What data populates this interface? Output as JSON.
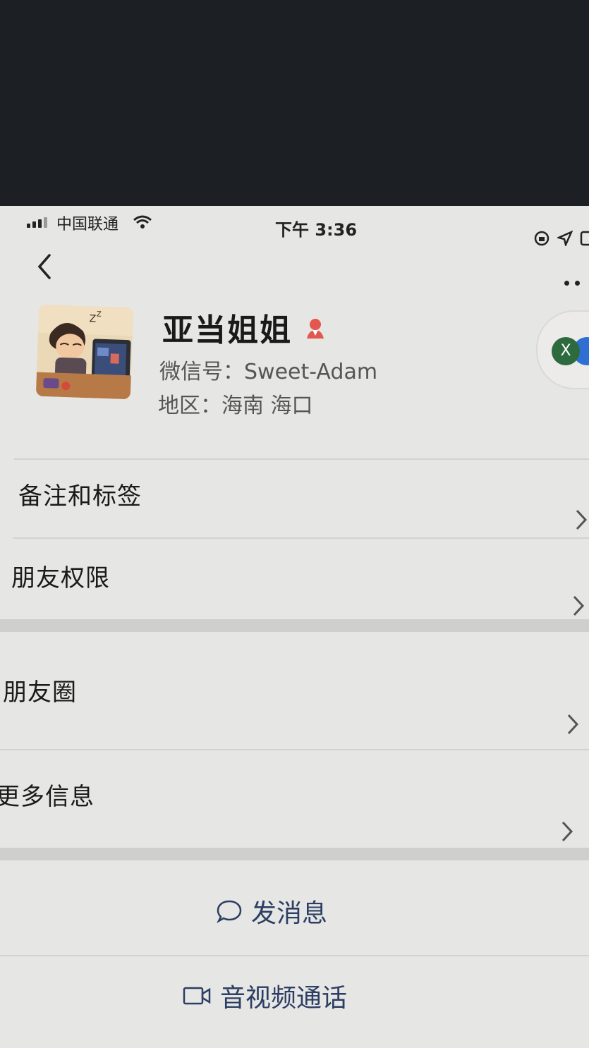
{
  "status_bar": {
    "carrier": "中国联通",
    "time": "下午 3:36"
  },
  "profile": {
    "name": "亚当姐姐",
    "wechat_id": "微信号：Sweet-Adam",
    "region": "地区：海南 海口",
    "status_badge_letter": "X"
  },
  "menu_items": [
    {
      "label": "备注和标签"
    },
    {
      "label": "朋友权限"
    },
    {
      "label": "朋友圈"
    },
    {
      "label": "更多信息"
    }
  ],
  "actions": {
    "send_message": "发消息",
    "video_call": "音视频通话"
  },
  "colors": {
    "page_bg": "#e6e6e4",
    "text_primary": "#1a1a1a",
    "text_secondary": "#555555",
    "action_text": "#2c3e63",
    "gender_icon": "#e4574f"
  },
  "icons": [
    "back-icon",
    "more-icon",
    "gender-female-icon",
    "chevron-right-icon",
    "chat-bubble-icon",
    "video-camera-icon",
    "wifi-icon",
    "signal-icon"
  ]
}
